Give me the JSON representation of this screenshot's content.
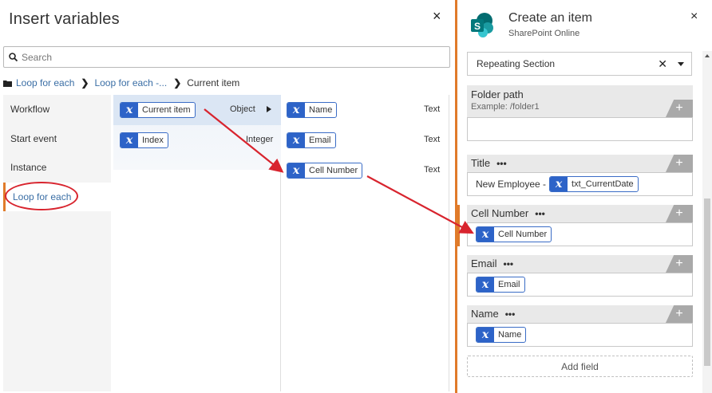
{
  "insert_panel": {
    "title": "Insert variables",
    "close_icon": "×",
    "search_placeholder": "Search",
    "breadcrumb": [
      "Loop for each",
      "Loop for each -...",
      "Current item"
    ],
    "categories": [
      "Workflow",
      "Start event",
      "Instance",
      "Loop for each"
    ],
    "active_category": "Loop for each",
    "variables_col1": [
      {
        "name": "Current item",
        "type": "Object",
        "selected": true
      },
      {
        "name": "Index",
        "type": "Integer",
        "selected": false
      }
    ],
    "variables_col2": [
      {
        "name": "Name",
        "type": "Text"
      },
      {
        "name": "Email",
        "type": "Text"
      },
      {
        "name": "Cell Number",
        "type": "Text"
      }
    ]
  },
  "action_panel": {
    "title": "Create an item",
    "subtitle": "SharePoint Online",
    "close_icon": "×",
    "section_value": "Repeating Section",
    "section_clear": "✕",
    "folder_field": {
      "label": "Folder path",
      "hint": "Example: /folder1"
    },
    "fields": [
      {
        "label": "Title",
        "prefix": "New Employee - ",
        "variable": "txt_CurrentDate"
      },
      {
        "label": "Cell Number",
        "prefix": "",
        "variable": "Cell Number"
      },
      {
        "label": "Email",
        "prefix": "",
        "variable": "Email"
      },
      {
        "label": "Name",
        "prefix": "",
        "variable": "Name"
      }
    ],
    "dots": "•••",
    "plus": "+",
    "add_field_label": "Add field"
  },
  "variable_glyph": "x",
  "colors": {
    "accent_orange": "#e07b2a",
    "variable_blue": "#2d63c8",
    "link_blue": "#3a6ea5",
    "annotation_red": "#d8242e",
    "sharepoint_teal": "#036c70"
  }
}
